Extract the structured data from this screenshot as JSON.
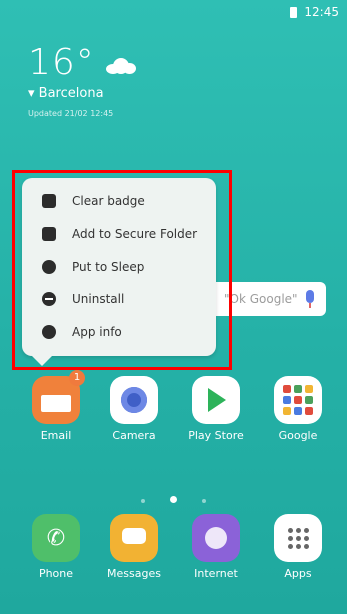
{
  "status_bar": {
    "time": "12:45"
  },
  "weather": {
    "temperature": "16°",
    "city": "Barcelona",
    "updated": "Updated 21/02 12:45"
  },
  "search": {
    "hint": "\"Ok Google\""
  },
  "context_menu": {
    "items": [
      {
        "label": "Clear badge",
        "icon": "badge-icon"
      },
      {
        "label": "Add to Secure Folder",
        "icon": "secure-folder-icon"
      },
      {
        "label": "Put to Sleep",
        "icon": "sleep-icon"
      },
      {
        "label": "Uninstall",
        "icon": "minus-circle-icon"
      },
      {
        "label": "App info",
        "icon": "info-icon"
      }
    ]
  },
  "home_apps": [
    {
      "label": "Email",
      "badge": "1"
    },
    {
      "label": "Camera"
    },
    {
      "label": "Play Store"
    },
    {
      "label": "Google"
    }
  ],
  "dock_apps": [
    {
      "label": "Phone"
    },
    {
      "label": "Messages"
    },
    {
      "label": "Internet"
    },
    {
      "label": "Apps"
    }
  ],
  "colors": {
    "background": "#2fbfb4",
    "highlight": "#ff0000",
    "email": "#f0813b",
    "phone": "#4fbf6a",
    "messages": "#f2b233",
    "internet": "#8b62d8"
  }
}
